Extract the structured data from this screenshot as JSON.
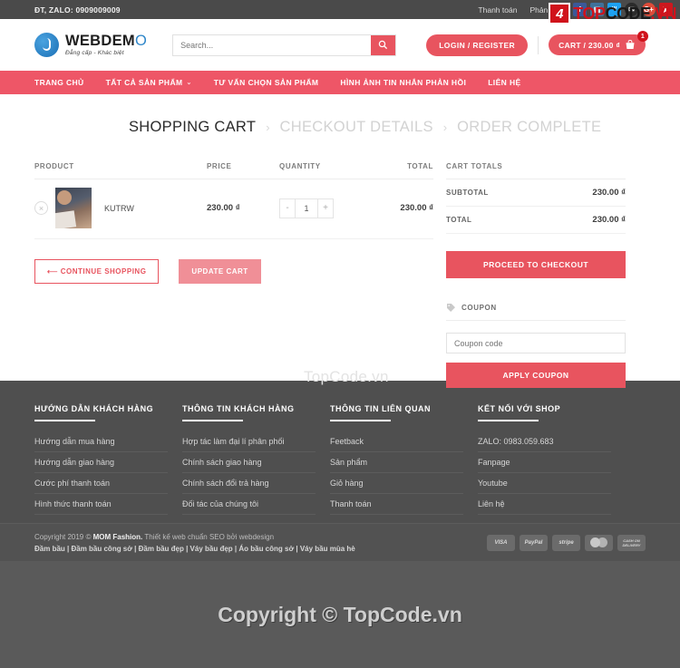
{
  "topbar": {
    "phone": "ĐT, ZALO: 0909009009",
    "links": [
      "Thanh toán",
      "Phản hồi"
    ],
    "socials": [
      {
        "name": "facebook-icon",
        "glyph": "f",
        "class": "soc-fb"
      },
      {
        "name": "instagram-icon",
        "glyph": "▣",
        "class": "soc-ig"
      },
      {
        "name": "twitter-icon",
        "glyph": "ᵂ",
        "class": "soc-tw"
      },
      {
        "name": "email-icon",
        "glyph": "✉",
        "class": "soc-em"
      },
      {
        "name": "google-plus-icon",
        "glyph": "G+",
        "class": "soc-gp"
      },
      {
        "name": "youtube-icon",
        "glyph": "▶",
        "class": "soc-yt"
      }
    ]
  },
  "watermark": {
    "logo_mark": "4",
    "logo_top": "TOP",
    "logo_code": "CODE",
    "logo_vn": ".VN",
    "middle": "TopCode.vn",
    "bottom": "Copyright © TopCode.vn"
  },
  "header": {
    "logo_name": "WEBDEM",
    "logo_name_o": "O",
    "logo_tagline": "Đẳng cấp - Khác biệt",
    "search_placeholder": "Search...",
    "search_value": "",
    "login_label": "LOGIN / REGISTER",
    "cart_label": "CART / 230.00 ₫",
    "cart_count": "1"
  },
  "nav": {
    "items": [
      {
        "label": "TRANG CHỦ",
        "caret": ""
      },
      {
        "label": "TẤT CẢ SẢN PHẨM",
        "caret": "⌄"
      },
      {
        "label": "TƯ VẤN CHỌN SẢN PHẨM",
        "caret": ""
      },
      {
        "label": "HÌNH ẢNH TIN NHẮN PHẢN HỒI",
        "caret": ""
      },
      {
        "label": "LIÊN HỆ",
        "caret": ""
      }
    ]
  },
  "steps": {
    "active": "SHOPPING CART",
    "sep1": "›",
    "second": "CHECKOUT DETAILS",
    "sep2": "›",
    "third": "ORDER COMPLETE"
  },
  "cart": {
    "headers": {
      "product": "PRODUCT",
      "price": "PRICE",
      "quantity": "QUANTITY",
      "total": "TOTAL"
    },
    "rows": [
      {
        "remove": "×",
        "name": "KUTRW",
        "price": "230.00 ₫",
        "qty_minus": "-",
        "qty": "1",
        "qty_plus": "+",
        "total": "230.00 ₫"
      }
    ],
    "continue_label": "⟵  CONTINUE SHOPPING",
    "update_label": "UPDATE CART"
  },
  "totals": {
    "title": "CART TOTALS",
    "rows": [
      {
        "label": "SUBTOTAL",
        "value": "230.00 ₫"
      },
      {
        "label": "TOTAL",
        "value": "230.00 ₫"
      }
    ],
    "checkout_label": "PROCEED TO CHECKOUT",
    "coupon_title": "COUPON",
    "coupon_placeholder": "Coupon code",
    "coupon_value": "",
    "apply_label": "APPLY COUPON"
  },
  "footer": {
    "columns": [
      {
        "title": "HƯỚNG DẪN KHÁCH HÀNG",
        "items": [
          "Hướng dẫn mua hàng",
          "Hướng dẫn giao hàng",
          "Cước phí thanh toán",
          "Hình thức thanh toán"
        ]
      },
      {
        "title": "THÔNG TIN KHÁCH HÀNG",
        "items": [
          "Hợp tác làm đại lí phân phối",
          "Chính sách giao hàng",
          "Chính sách đổi trả hàng",
          "Đối tác của chúng tôi"
        ]
      },
      {
        "title": "THÔNG TIN LIÊN QUAN",
        "items": [
          "Feetback",
          "Sản phẩm",
          "Giỏ hàng",
          "Thanh toán"
        ]
      },
      {
        "title": "KẾT NỐI VỚI SHOP",
        "items": [
          "ZALO: 0983.059.683",
          "Fanpage",
          "Youtube",
          "Liên hệ"
        ]
      }
    ],
    "copyright_prefix": "Copyright 2019 © ",
    "copyright_brand": "MOM Fashion.",
    "copyright_suffix": " Thiết kế web chuẩn SEO bởi webdesign",
    "tags": "Đầm bầu | Đầm bầu công sở | Đầm bầu đẹp | Váy bầu đẹp | Áo bầu công sở | Váy bầu mùa hè",
    "payments": [
      {
        "name": "visa-icon",
        "label": "VISA"
      },
      {
        "name": "paypal-icon",
        "label": "PayPal"
      },
      {
        "name": "stripe-icon",
        "label": "stripe"
      },
      {
        "name": "mastercard-icon",
        "label": ""
      },
      {
        "name": "cash-on-delivery-icon",
        "label": "CASH ON DELIVERY"
      }
    ]
  }
}
